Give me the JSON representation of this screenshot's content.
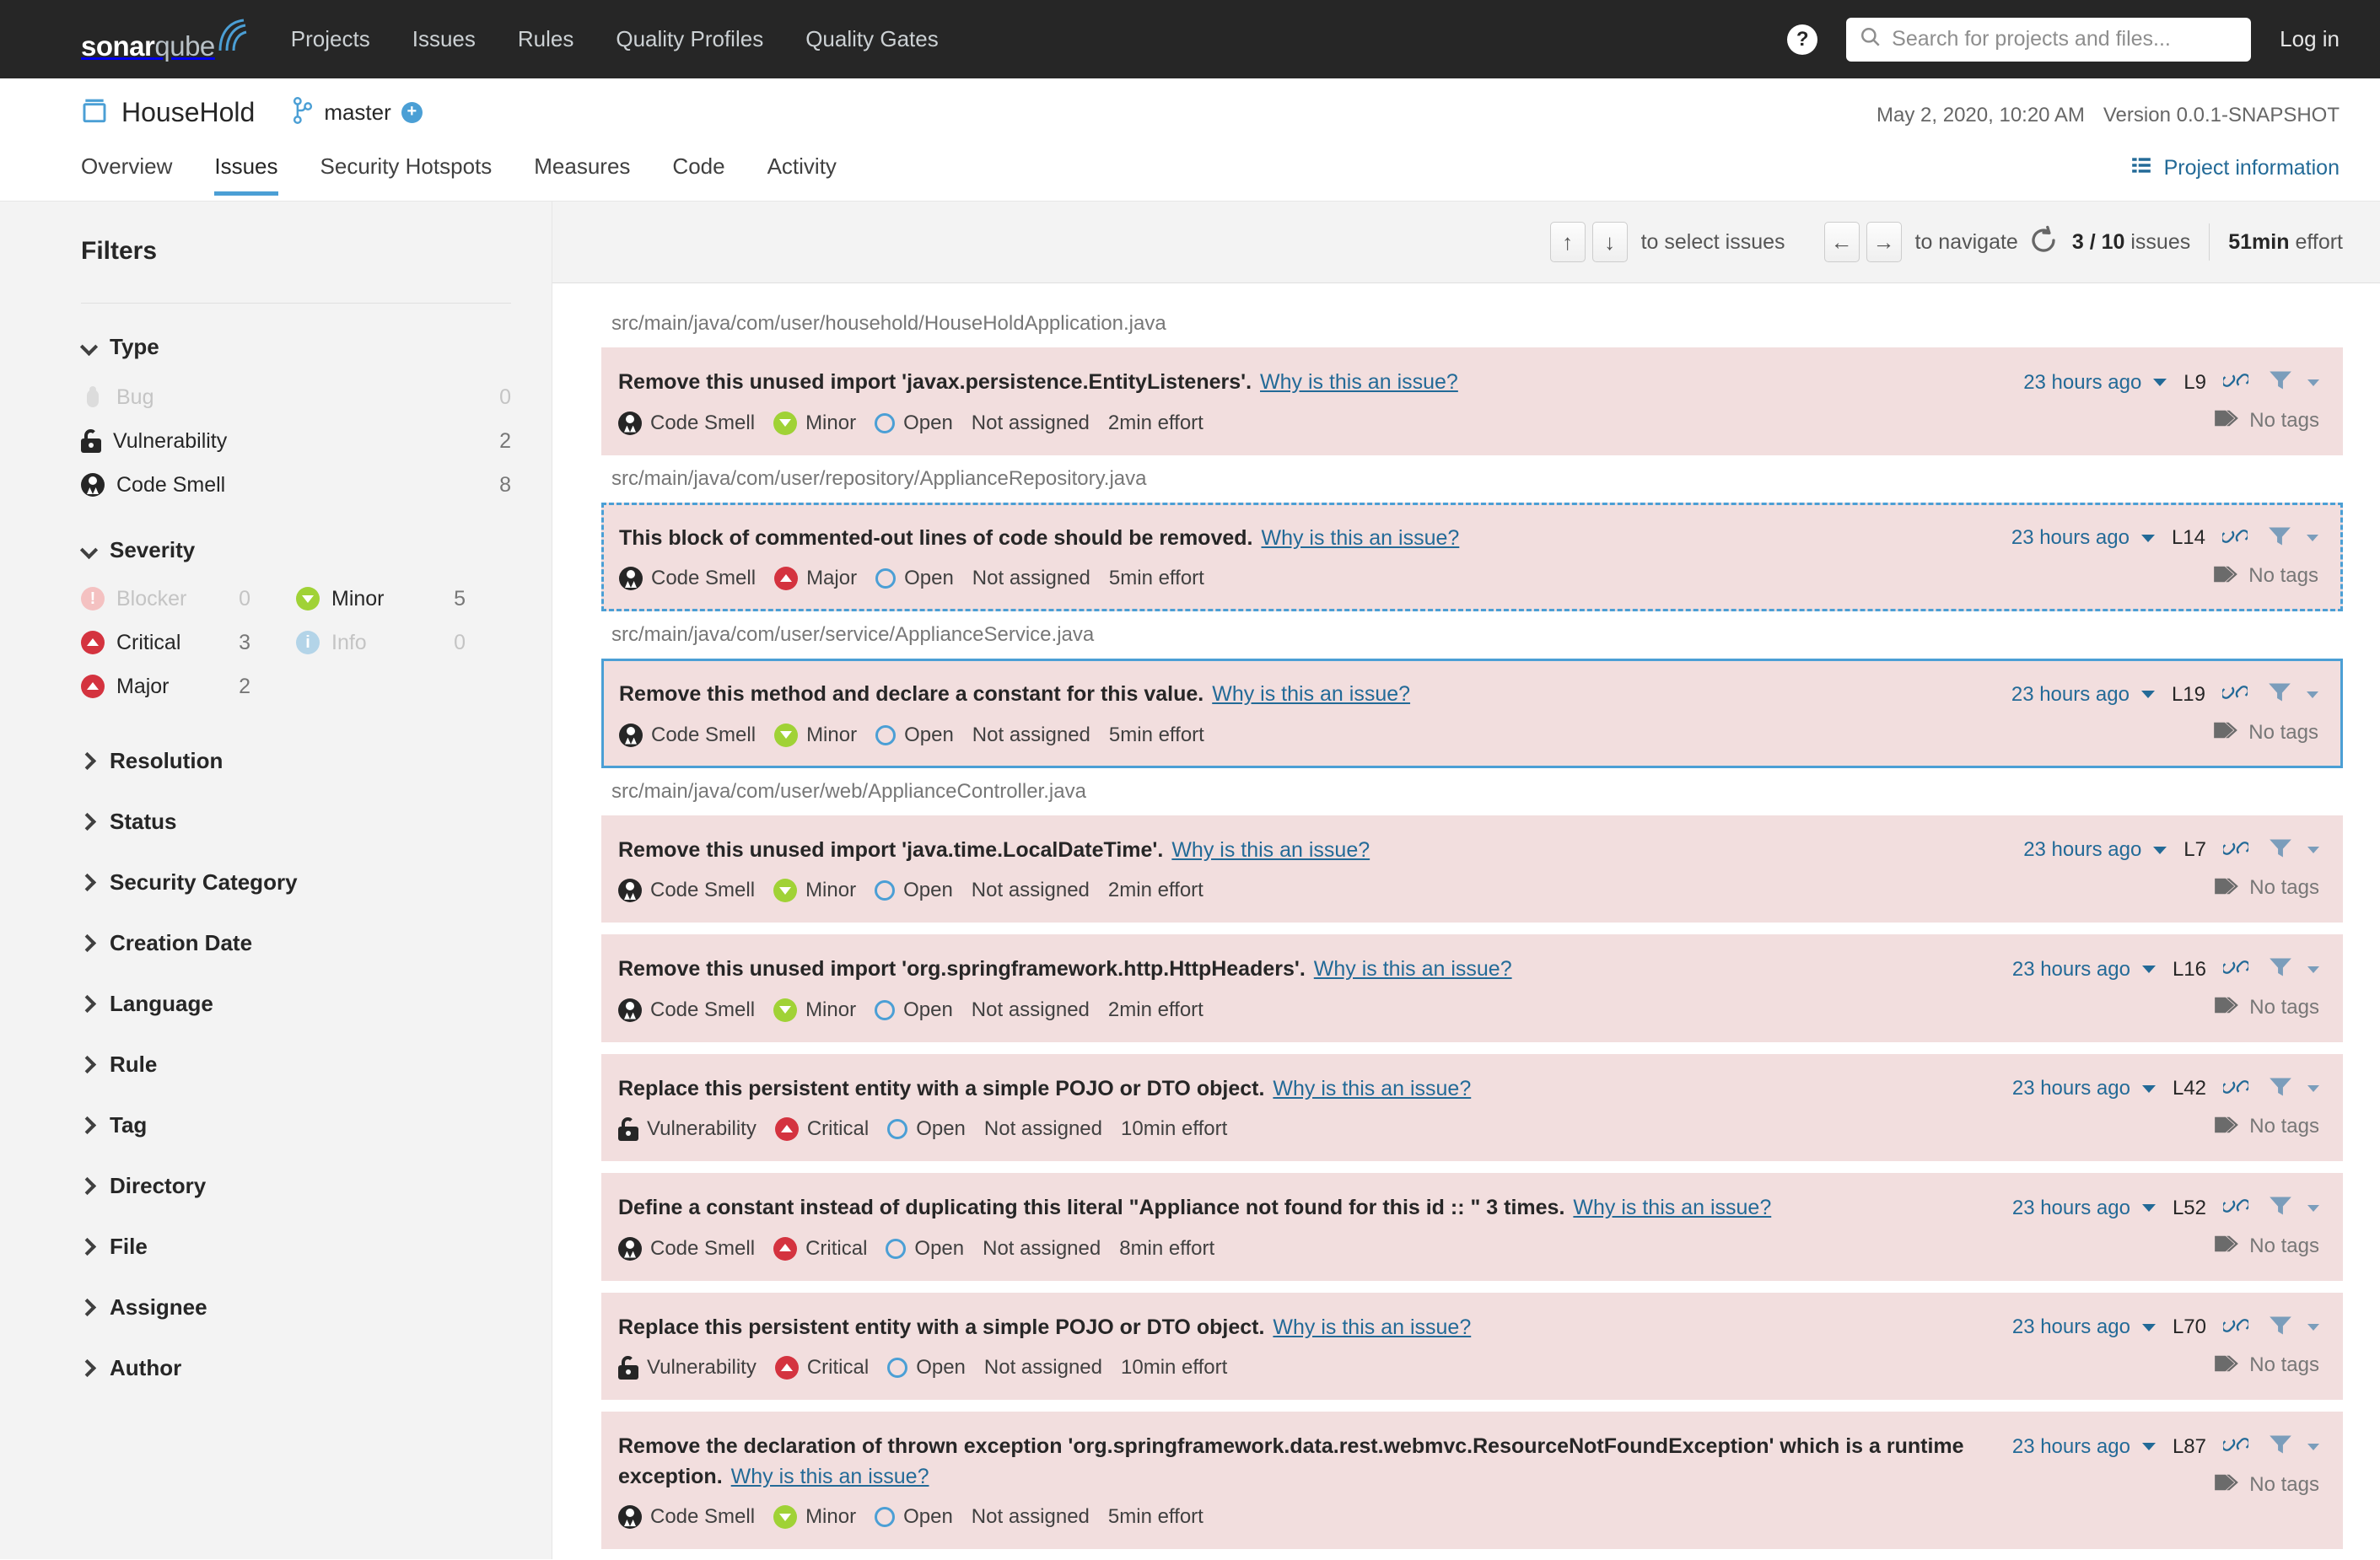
{
  "global_nav": {
    "logo": {
      "bold": "sonar",
      "light": "qube"
    },
    "links": [
      "Projects",
      "Issues",
      "Rules",
      "Quality Profiles",
      "Quality Gates"
    ],
    "help_icon": "help-icon",
    "search_placeholder": "Search for projects and files...",
    "search_value": "",
    "login_label": "Log in"
  },
  "project": {
    "name": "HouseHold",
    "branch": "master",
    "analysis_date": "May 2, 2020, 10:20 AM",
    "version": "Version 0.0.1-SNAPSHOT",
    "project_information_label": "Project information",
    "tabs": [
      {
        "label": "Overview",
        "active": false
      },
      {
        "label": "Issues",
        "active": true
      },
      {
        "label": "Security Hotspots",
        "active": false
      },
      {
        "label": "Measures",
        "active": false
      },
      {
        "label": "Code",
        "active": false
      },
      {
        "label": "Activity",
        "active": false
      }
    ]
  },
  "sidebar": {
    "title": "Filters",
    "type_facet": {
      "title": "Type",
      "items": [
        {
          "label": "Bug",
          "count": "0",
          "icon": "bug-icon",
          "disabled": true
        },
        {
          "label": "Vulnerability",
          "count": "2",
          "icon": "vulnerability-icon",
          "disabled": false
        },
        {
          "label": "Code Smell",
          "count": "8",
          "icon": "code-smell-icon",
          "disabled": false
        }
      ]
    },
    "severity_facet": {
      "title": "Severity",
      "items": [
        {
          "label": "Blocker",
          "count": "0",
          "icon": "severity-blocker-icon",
          "disabled": true
        },
        {
          "label": "Minor",
          "count": "5",
          "icon": "severity-minor-icon",
          "disabled": false
        },
        {
          "label": "Critical",
          "count": "3",
          "icon": "severity-critical-icon",
          "disabled": false
        },
        {
          "label": "Info",
          "count": "0",
          "icon": "severity-info-icon",
          "disabled": true
        },
        {
          "label": "Major",
          "count": "2",
          "icon": "severity-major-icon",
          "disabled": false
        }
      ]
    },
    "collapsed_facets": [
      "Resolution",
      "Status",
      "Security Category",
      "Creation Date",
      "Language",
      "Rule",
      "Tag",
      "Directory",
      "File",
      "Assignee",
      "Author"
    ]
  },
  "toolbar": {
    "key_up": "↑",
    "key_down": "↓",
    "select_hint": "to select issues",
    "key_left": "←",
    "key_right": "→",
    "navigate_hint": "to navigate",
    "reload_icon": "reload-icon",
    "issues_current": "3",
    "issues_separator": "/",
    "issues_total": "10",
    "issues_word": "issues",
    "effort_value": "51min",
    "effort_word": "effort"
  },
  "issue_groups": [
    {
      "path": "src/main/java/com/user/household/HouseHoldApplication.java",
      "issues": [
        {
          "message": "Remove this unused import 'javax.persistence.EntityListeners'.",
          "why": "Why is this an issue?",
          "type": "Code Smell",
          "type_icon": "code-smell-icon",
          "severity": "Minor",
          "severity_icon": "severity-minor-icon",
          "status": "Open",
          "assignee": "Not assigned",
          "effort": "2min effort",
          "ago": "23 hours ago",
          "line": "L9",
          "tags": "No tags",
          "state": "normal"
        }
      ]
    },
    {
      "path": "src/main/java/com/user/repository/ApplianceRepository.java",
      "issues": [
        {
          "message": "This block of commented-out lines of code should be removed.",
          "why": "Why is this an issue?",
          "type": "Code Smell",
          "type_icon": "code-smell-icon",
          "severity": "Major",
          "severity_icon": "severity-major-icon",
          "status": "Open",
          "assignee": "Not assigned",
          "effort": "5min effort",
          "ago": "23 hours ago",
          "line": "L14",
          "tags": "No tags",
          "state": "focused"
        }
      ]
    },
    {
      "path": "src/main/java/com/user/service/ApplianceService.java",
      "issues": [
        {
          "message": "Remove this method and declare a constant for this value.",
          "why": "Why is this an issue?",
          "type": "Code Smell",
          "type_icon": "code-smell-icon",
          "severity": "Minor",
          "severity_icon": "severity-minor-icon",
          "status": "Open",
          "assignee": "Not assigned",
          "effort": "5min effort",
          "ago": "23 hours ago",
          "line": "L19",
          "tags": "No tags",
          "state": "selected"
        }
      ]
    },
    {
      "path": "src/main/java/com/user/web/ApplianceController.java",
      "issues": [
        {
          "message": "Remove this unused import 'java.time.LocalDateTime'.",
          "why": "Why is this an issue?",
          "type": "Code Smell",
          "type_icon": "code-smell-icon",
          "severity": "Minor",
          "severity_icon": "severity-minor-icon",
          "status": "Open",
          "assignee": "Not assigned",
          "effort": "2min effort",
          "ago": "23 hours ago",
          "line": "L7",
          "tags": "No tags",
          "state": "normal"
        },
        {
          "message": "Remove this unused import 'org.springframework.http.HttpHeaders'.",
          "why": "Why is this an issue?",
          "type": "Code Smell",
          "type_icon": "code-smell-icon",
          "severity": "Minor",
          "severity_icon": "severity-minor-icon",
          "status": "Open",
          "assignee": "Not assigned",
          "effort": "2min effort",
          "ago": "23 hours ago",
          "line": "L16",
          "tags": "No tags",
          "state": "normal"
        },
        {
          "message": "Replace this persistent entity with a simple POJO or DTO object.",
          "why": "Why is this an issue?",
          "type": "Vulnerability",
          "type_icon": "vulnerability-icon",
          "severity": "Critical",
          "severity_icon": "severity-critical-icon",
          "status": "Open",
          "assignee": "Not assigned",
          "effort": "10min effort",
          "ago": "23 hours ago",
          "line": "L42",
          "tags": "No tags",
          "state": "normal"
        },
        {
          "message": "Define a constant instead of duplicating this literal \"Appliance not found for this id :: \" 3 times.",
          "why": "Why is this an issue?",
          "type": "Code Smell",
          "type_icon": "code-smell-icon",
          "severity": "Critical",
          "severity_icon": "severity-critical-icon",
          "status": "Open",
          "assignee": "Not assigned",
          "effort": "8min effort",
          "ago": "23 hours ago",
          "line": "L52",
          "tags": "No tags",
          "state": "normal"
        },
        {
          "message": "Replace this persistent entity with a simple POJO or DTO object.",
          "why": "Why is this an issue?",
          "type": "Vulnerability",
          "type_icon": "vulnerability-icon",
          "severity": "Critical",
          "severity_icon": "severity-critical-icon",
          "status": "Open",
          "assignee": "Not assigned",
          "effort": "10min effort",
          "ago": "23 hours ago",
          "line": "L70",
          "tags": "No tags",
          "state": "normal"
        },
        {
          "message": "Remove the declaration of thrown exception 'org.springframework.data.rest.webmvc.ResourceNotFoundException' which is a runtime exception.",
          "why": "Why is this an issue?",
          "type": "Code Smell",
          "type_icon": "code-smell-icon",
          "severity": "Minor",
          "severity_icon": "severity-minor-icon",
          "status": "Open",
          "assignee": "Not assigned",
          "effort": "5min effort",
          "ago": "23 hours ago",
          "line": "L87",
          "tags": "No tags",
          "state": "normal"
        }
      ]
    }
  ],
  "colors": {
    "brand_dark": "#262626",
    "accent_blue": "#4b9fd5",
    "link_blue": "#236a97",
    "issue_bg": "#f2dede",
    "minor_green": "#a0d236",
    "critical_red": "#d4333f",
    "sidebar_bg": "#f3f3f3"
  }
}
